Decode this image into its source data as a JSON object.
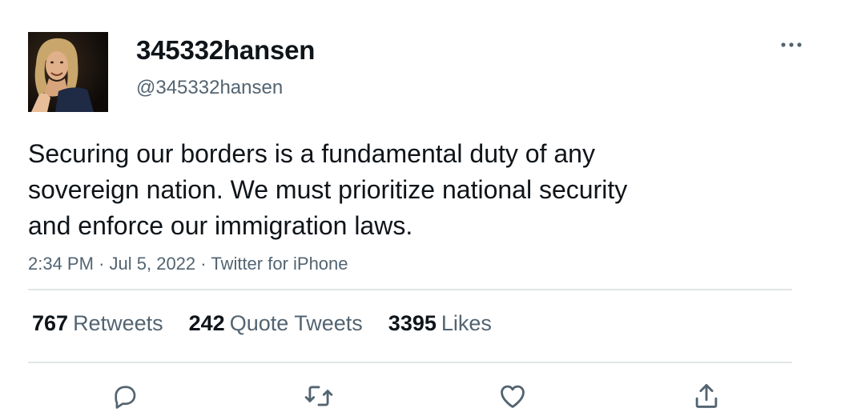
{
  "author": {
    "display_name": "345332hansen",
    "handle": "@345332hansen",
    "avatar_icon": "profile-photo"
  },
  "tweet": {
    "text_lines": [
      "Securing our borders is a fundamental duty of any",
      "sovereign nation. We must prioritize national security",
      "and enforce our immigration laws."
    ],
    "time": "2:34 PM",
    "separator": "·",
    "date": "Jul 5, 2022",
    "source": "Twitter for iPhone"
  },
  "stats": {
    "retweets_count": "767",
    "retweets_label": "Retweets",
    "quotes_count": "242",
    "quotes_label": "Quote Tweets",
    "likes_count": "3395",
    "likes_label": "Likes"
  },
  "actions": [
    "reply-icon",
    "retweet-icon",
    "like-icon",
    "share-icon"
  ],
  "colors": {
    "text": "#0f1419",
    "secondary": "#536471",
    "divider": "#e1e5e8"
  }
}
